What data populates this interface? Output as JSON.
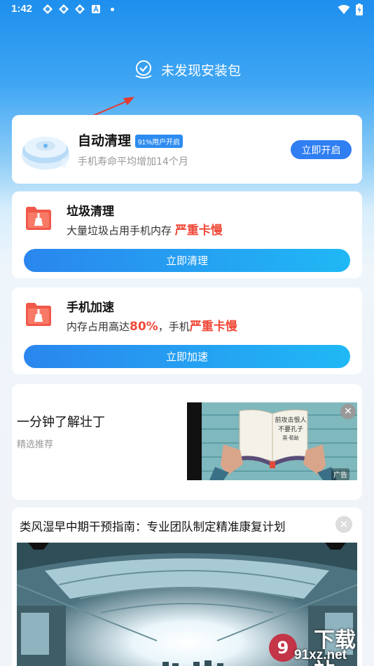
{
  "status_bar": {
    "time": "1:42",
    "icons": [
      "sync-icon",
      "sync-icon",
      "sync-icon",
      "a-icon",
      "dot-icon",
      "wifi-icon",
      "battery-charging-icon"
    ]
  },
  "scan_status": {
    "text": "未发现安装包",
    "icon": "shield-check-icon"
  },
  "auto_clean": {
    "title": "自动清理",
    "badge": "91%用户开启",
    "subtitle": "手机寿命平均增加14个月",
    "button": "立即开启",
    "icon": "robot-vacuum-icon"
  },
  "junk_clean": {
    "title": "垃圾清理",
    "desc_prefix": "大量垃圾占用手机内存",
    "desc_highlight": "严重卡慢",
    "button": "立即清理",
    "icon": "folder-broom-icon"
  },
  "phone_speed": {
    "title": "手机加速",
    "desc_prefix": "内存占用高达",
    "desc_percent": "80%",
    "desc_mid": "，手机",
    "desc_highlight": "严重卡慢",
    "button": "立即加速",
    "icon": "folder-broom-icon"
  },
  "ad": {
    "title": "一分钟了解壮丁",
    "subtitle": "精选推荐",
    "tag": "广告",
    "close_icon": "close-icon",
    "book_text_1": "前攻击恨人",
    "book_text_2": "不要孔子",
    "book_text_3": "英·荀助"
  },
  "news": {
    "title": "类风湿早中期干预指南：专业团队制定精准康复计划",
    "close_icon": "close-icon"
  },
  "watermark": {
    "cn": "下载站",
    "url": "91xz.net"
  },
  "colors": {
    "primary": "#2f7ef2",
    "highlight_red": "#f04a3a",
    "header_blue": "#1e8fee"
  }
}
